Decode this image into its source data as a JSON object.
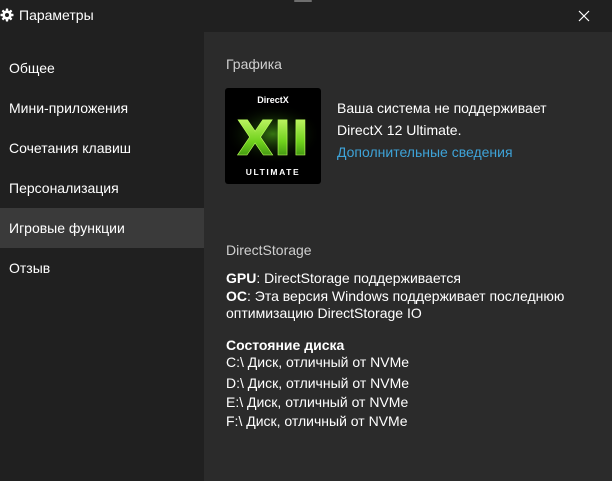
{
  "window": {
    "title": "Параметры",
    "icon": "gear-icon",
    "close_icon": "close-icon"
  },
  "sidebar": {
    "items": [
      {
        "label": "Общее",
        "active": false
      },
      {
        "label": "Мини-приложения",
        "active": false
      },
      {
        "label": "Сочетания клавиш",
        "active": false
      },
      {
        "label": "Персонализация",
        "active": false
      },
      {
        "label": "Игровые функции",
        "active": true
      },
      {
        "label": "Отзыв",
        "active": false
      }
    ]
  },
  "graphics": {
    "section_title": "Графика",
    "logo": {
      "top_text": "DirectX",
      "main_text": "XII",
      "bottom_text": "ULTIMATE"
    },
    "message_line1": "Ваша система не поддерживает",
    "message_line2": "DirectX 12 Ultimate.",
    "more_info_link": "Дополнительные сведения"
  },
  "directstorage": {
    "section_title": "DirectStorage",
    "gpu_label": "GPU",
    "gpu_text": ": DirectStorage поддерживается",
    "os_label": "ОС",
    "os_text_line1": ": Эта версия Windows поддерживает последнюю",
    "os_text_line2": "оптимизацию DirectStorage IO",
    "disk_status_title": "Состояние диска",
    "disks": [
      "C:\\ Диск, отличный от NVMe",
      "D:\\ Диск, отличный от NVMe",
      "E:\\ Диск, отличный от NVMe",
      "F:\\ Диск, отличный от NVMe"
    ]
  },
  "colors": {
    "background": "#202020",
    "content_background": "#2b2b2b",
    "active_item": "#3a3a3a",
    "link": "#3ea3d8",
    "directx_green": "#7fe020"
  }
}
